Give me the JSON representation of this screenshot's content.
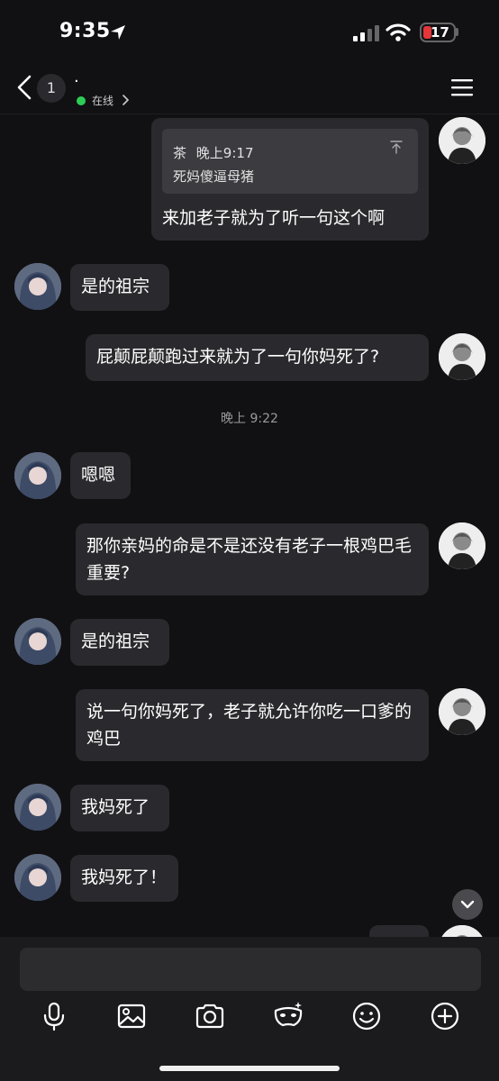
{
  "status_bar": {
    "time": "9:35",
    "battery": "17"
  },
  "header": {
    "unread_count": "1",
    "contact_name": "·",
    "online_status": "在线"
  },
  "messages": [
    {
      "side": "self",
      "quote": {
        "sender": "茶",
        "time": "晚上9:17",
        "text": "死妈傻逼母猪"
      },
      "text": "来加老子就为了听一句这个啊"
    },
    {
      "side": "other",
      "text": "是的祖宗"
    },
    {
      "side": "self",
      "text": "屁颠屁颠跑过来就为了一句你妈死了?"
    },
    {
      "side": "other",
      "text": "嗯嗯"
    },
    {
      "side": "self",
      "text": "那你亲妈的命是不是还没有老子一根鸡巴毛重要?"
    },
    {
      "side": "other",
      "text": "是的祖宗"
    },
    {
      "side": "self",
      "text": "说一句你妈死了，老子就允许你吃一口爹的鸡巴"
    },
    {
      "side": "other",
      "text": "我妈死了"
    },
    {
      "side": "other",
      "text": "我妈死了！"
    }
  ],
  "time_separator": "晚上 9:22",
  "composer": {
    "value": "",
    "placeholder": ""
  },
  "icons": [
    "location-arrow-icon",
    "signal-icon",
    "wifi-icon",
    "battery-icon",
    "back-icon",
    "chevron-right-icon",
    "menu-icon",
    "pin-top-icon",
    "chevron-down-icon",
    "microphone-icon",
    "image-icon",
    "camera-icon",
    "mask-icon",
    "emoji-icon",
    "plus-icon"
  ],
  "colors": {
    "background": "#111114",
    "bubble": "#2a2a2e",
    "online": "#2ecc55",
    "battery_low": "#e5363a"
  }
}
